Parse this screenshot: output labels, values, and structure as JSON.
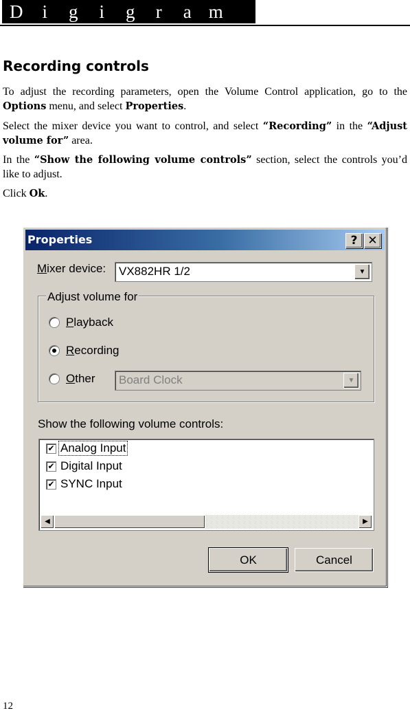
{
  "header": {
    "brand_letters": [
      "D",
      "i",
      "g",
      "i",
      "g",
      "r",
      "a",
      "m"
    ]
  },
  "section_title": "Recording controls",
  "paragraphs": {
    "p1_a": "To adjust the recording parameters, open the Volume Control application, go to the ",
    "p1_b": "Options",
    "p1_c": " menu, and select ",
    "p1_d": "Properties",
    "p1_e": ".",
    "p2_a": "Select the mixer device you want to control, and select ",
    "p2_b": "“Recording”",
    "p2_c": " in the ",
    "p2_d": "“Adjust volume for”",
    "p2_e": " area.",
    "p3_a": "In the ",
    "p3_b": "“Show the following volume controls”",
    "p3_c": " section, select the controls you’d like to adjust.",
    "p4_a": "Click ",
    "p4_b": "Ok",
    "p4_c": "."
  },
  "dialog": {
    "title": "Properties",
    "help_glyph": "?",
    "close_glyph": "✕",
    "mixer_label_u": "M",
    "mixer_label_rest": "ixer device:",
    "mixer_value": "VX882HR 1/2",
    "adjust_group_label": "Adjust volume for",
    "radios": [
      {
        "u": "P",
        "rest": "layback",
        "selected": false
      },
      {
        "u": "R",
        "rest": "ecording",
        "selected": true
      },
      {
        "u": "O",
        "rest": "ther",
        "selected": false
      }
    ],
    "other_value": "Board Clock",
    "controls_label": "Show the following volume controls:",
    "controls": [
      {
        "label": "Analog Input",
        "checked": true
      },
      {
        "label": "Digital Input",
        "checked": true
      },
      {
        "label": "SYNC Input",
        "checked": true
      }
    ],
    "check_glyph": "✔",
    "arrow_down": "▼",
    "arrow_left": "◀",
    "arrow_right": "▶",
    "ok_label": "OK",
    "cancel_label": "Cancel"
  },
  "page_number": "12"
}
